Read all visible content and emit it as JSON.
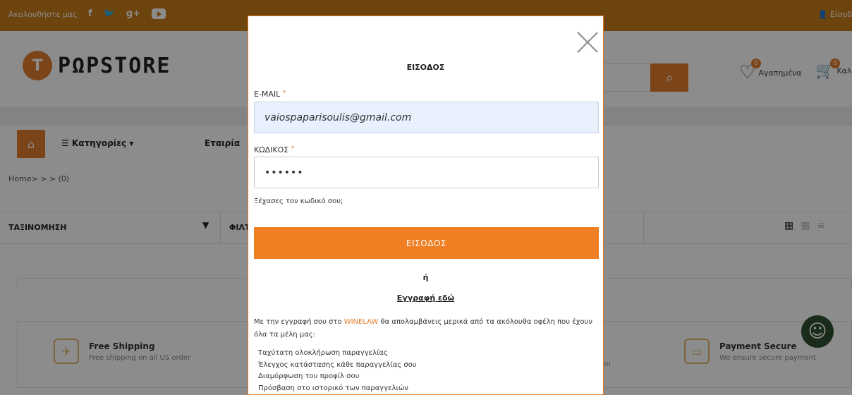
{
  "topbar": {
    "follow_label": "Ακολουθήστε μας",
    "social": [
      "f",
      "🐦",
      "g+"
    ],
    "login_label": "Είσοδ"
  },
  "header": {
    "logo_letter": "T",
    "logo_text": "PΩPSTORE",
    "wishlist_label": "Αγαπημένα",
    "wishlist_count": "0",
    "cart_label": "Καλ",
    "cart_count": "0"
  },
  "nav": {
    "categories_label": "☰ Κατηγορίες ▾",
    "company_label": "Εταιρία"
  },
  "breadcrumb": "Home> > > (0)",
  "sort": {
    "label": "ΤΑΞΙΝΟΜΗΣΗ",
    "filter_label": "ΦΙΛΤ"
  },
  "features": {
    "shipping_title": "Free Shipping",
    "shipping_desc": "Free shipping on all US order",
    "secure_title": "Payment Secure",
    "secure_desc": "We ensure secure payment",
    "middle_desc_tail": "m"
  },
  "modal": {
    "title": "ΕΙΣΟΔΟΣ",
    "email_label": "E-MAIL",
    "email_value": "vaiospaparisoulis@gmail.com",
    "password_label": "ΚΩΔΙΚΟΣ",
    "password_value": "••••••",
    "required_mark": "*",
    "forgot_label": "Ξέχασες τον κωδικό σου;",
    "submit_label": "ΕΙΣΟΔΟΣ",
    "or_label": "ή",
    "register_label": "Εγγραφή εδώ",
    "intro_before": "Με την εγγραφή σου στο ",
    "intro_brand": "WINELAW",
    "intro_after": " θα απολαμβάνεις μερικά από τα ακόλουθα οφέλη που έχουν όλα τα μέλη μας:",
    "benefits": [
      "Ταχύτατη ολοκλήρωση παραγγελίας",
      "Έλεγχος κατάστασης κάθε παραγγελίας σου",
      "Διαμόρφωση του προφίλ σου",
      "Πρόσβαση στο ιστορικό των παραγγελιών"
    ]
  },
  "colors": {
    "accent": "#ef7f22",
    "topbar": "#c87c1b",
    "email_field_bg": "#e8f0fe"
  }
}
